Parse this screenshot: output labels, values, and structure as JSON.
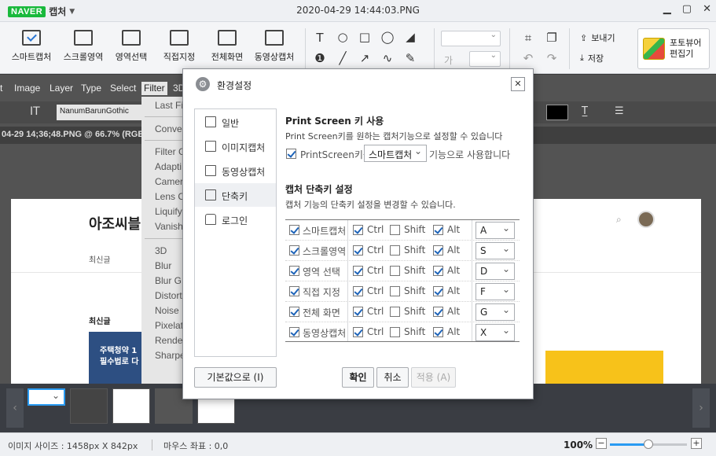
{
  "titlebar": {
    "brand": "NAVER",
    "app_name": "캡처",
    "window_title": "2020-04-29 14:44:03.PNG"
  },
  "toolbar": {
    "capture_tools": [
      {
        "label": "스마트캡처",
        "icon": "smart-capture-icon"
      },
      {
        "label": "스크롤영역",
        "icon": "scroll-area-icon"
      },
      {
        "label": "영역선택",
        "icon": "area-select-icon"
      },
      {
        "label": "직접지정",
        "icon": "direct-select-icon"
      },
      {
        "label": "전체화면",
        "icon": "fullscreen-icon"
      },
      {
        "label": "동영상캡처",
        "icon": "video-capture-icon"
      }
    ],
    "font_color_label": "가",
    "send_label": "보내기",
    "save_label": "저장",
    "editor_label_1": "포토뷰어",
    "editor_label_2": "편집기"
  },
  "photoshop": {
    "menu": [
      "t",
      "Image",
      "Layer",
      "Type",
      "Select",
      "Filter",
      "3D"
    ],
    "active_menu": "Filter",
    "font_name": "NanumBarunGothic",
    "doc_tab": "04-29 14;36;48.PNG @ 66.7% (RGB",
    "filter_items": [
      "Last Fi",
      "Conve",
      "Filter G",
      "Adapti",
      "Camer",
      "Lens C",
      "Liquify",
      "Vanish",
      "3D",
      "Blur",
      "Blur G",
      "Distort",
      "Noise",
      "Pixelat",
      "Rende",
      "Sharpe"
    ],
    "doc_title": "아조씨블",
    "doc_nav": "최신글",
    "doc_section": "최신글",
    "thumb_text_1": "주택청약 1",
    "thumb_text_2": "필수법로 다"
  },
  "dialog": {
    "title": "환경설정",
    "close_label": "✕",
    "nav": [
      {
        "label": "일반",
        "icon": "general-settings-icon"
      },
      {
        "label": "이미지캡처",
        "icon": "image-capture-icon"
      },
      {
        "label": "동영상캡처",
        "icon": "video-capture-icon"
      },
      {
        "label": "단축키",
        "icon": "shortcut-key-icon"
      },
      {
        "label": "로그인",
        "icon": "login-lock-icon"
      }
    ],
    "active_nav": "단축키",
    "printscreen": {
      "title": "Print Screen 키 사용",
      "desc": "Print Screen키를 원하는 캡처기능으로 설정할 수 있습니다",
      "checkbox_label": "PrintScreen키를",
      "checked": true,
      "selected": "스마트캡처",
      "suffix": "기능으로 사용합니다"
    },
    "shortcuts": {
      "title": "캡처 단축키 설정",
      "desc": "캡처 기능의 단축키 설정을 변경할 수 있습니다.",
      "ctrl_label": "Ctrl",
      "shift_label": "Shift",
      "alt_label": "Alt",
      "rows": [
        {
          "name": "스마트캡처",
          "enabled": true,
          "ctrl": true,
          "shift": false,
          "alt": true,
          "key": "A"
        },
        {
          "name": "스크롤영역",
          "enabled": true,
          "ctrl": true,
          "shift": false,
          "alt": true,
          "key": "S"
        },
        {
          "name": "영역 선택",
          "enabled": true,
          "ctrl": true,
          "shift": false,
          "alt": true,
          "key": "D"
        },
        {
          "name": "직접 지정",
          "enabled": true,
          "ctrl": true,
          "shift": false,
          "alt": true,
          "key": "F"
        },
        {
          "name": "전체 화면",
          "enabled": true,
          "ctrl": true,
          "shift": false,
          "alt": true,
          "key": "G"
        },
        {
          "name": "동영상캡처",
          "enabled": true,
          "ctrl": true,
          "shift": false,
          "alt": true,
          "key": "X"
        }
      ]
    },
    "reset_label": "기본값으로 (I)",
    "ok_label": "확인",
    "cancel_label": "취소",
    "apply_label": "적용 (A)"
  },
  "statusbar": {
    "image_size": "이미지 사이즈 : 1458px X 842px",
    "mouse_coords": "마우스 좌표 : 0,0",
    "zoom": "100%",
    "zoom_fraction": 0.5
  },
  "colors": {
    "accent": "#2a9bf2",
    "naver_green": "#19b93c",
    "checkbox_blue": "#1d63b8"
  }
}
